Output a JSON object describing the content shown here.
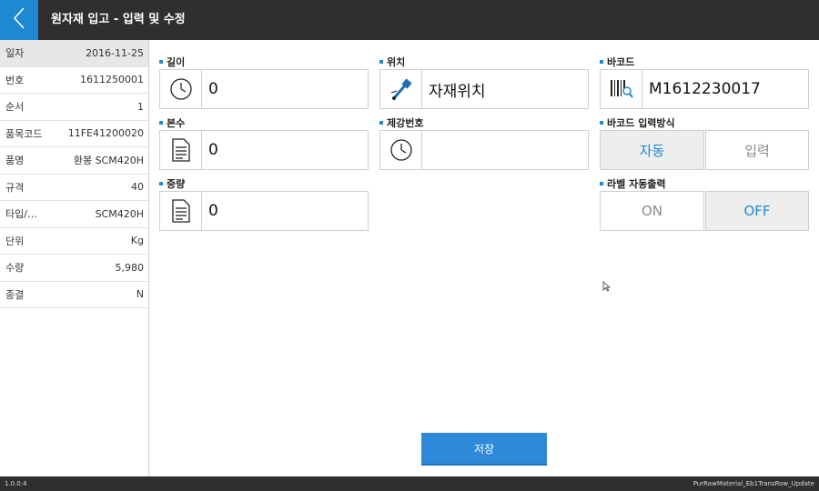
{
  "header": {
    "title": "원자재 입고 - 입력 및 수정",
    "back_icon": "chevron-left-icon"
  },
  "sidebar": {
    "rows": [
      {
        "label": "일자",
        "value": "2016-11-25"
      },
      {
        "label": "번호",
        "value": "1611250001"
      },
      {
        "label": "순서",
        "value": "1"
      },
      {
        "label": "품목코드",
        "value": "11FE41200020"
      },
      {
        "label": "품명",
        "value": "환봉 SCM420H"
      },
      {
        "label": "규격",
        "value": "40"
      },
      {
        "label": "타입/…",
        "value": "SCM420H"
      },
      {
        "label": "단위",
        "value": "Kg"
      },
      {
        "label": "수량",
        "value": "5,980"
      },
      {
        "label": "종결",
        "value": "N"
      }
    ]
  },
  "form": {
    "length": {
      "label": "길이",
      "value": "0",
      "icon": "clock-icon"
    },
    "location": {
      "label": "위치",
      "value": "자재위치",
      "icon": "drill-icon"
    },
    "barcode": {
      "label": "바코드",
      "value": "M1612230017",
      "icon": "barcode-scan-icon"
    },
    "count": {
      "label": "본수",
      "value": "0",
      "icon": "document-icon"
    },
    "steel_no": {
      "label": "제강번호",
      "value": "",
      "icon": "clock-icon"
    },
    "barcode_mode": {
      "label": "바코드 입력방식",
      "options": [
        "자동",
        "입력"
      ],
      "selected": "자동"
    },
    "weight": {
      "label": "중량",
      "value": "0",
      "icon": "document-icon"
    },
    "label_auto_print": {
      "label": "라벨 자동출력",
      "options": [
        "ON",
        "OFF"
      ],
      "selected": "OFF"
    }
  },
  "save_label": "저장",
  "footer": {
    "version": "1.0.0.4",
    "screen_id": "PurRawMaterial_Eb1TransRow_Update"
  },
  "colors": {
    "accent": "#1e88d2",
    "header_bg": "#2f2f2f",
    "save_button": "#2e8ad8"
  }
}
